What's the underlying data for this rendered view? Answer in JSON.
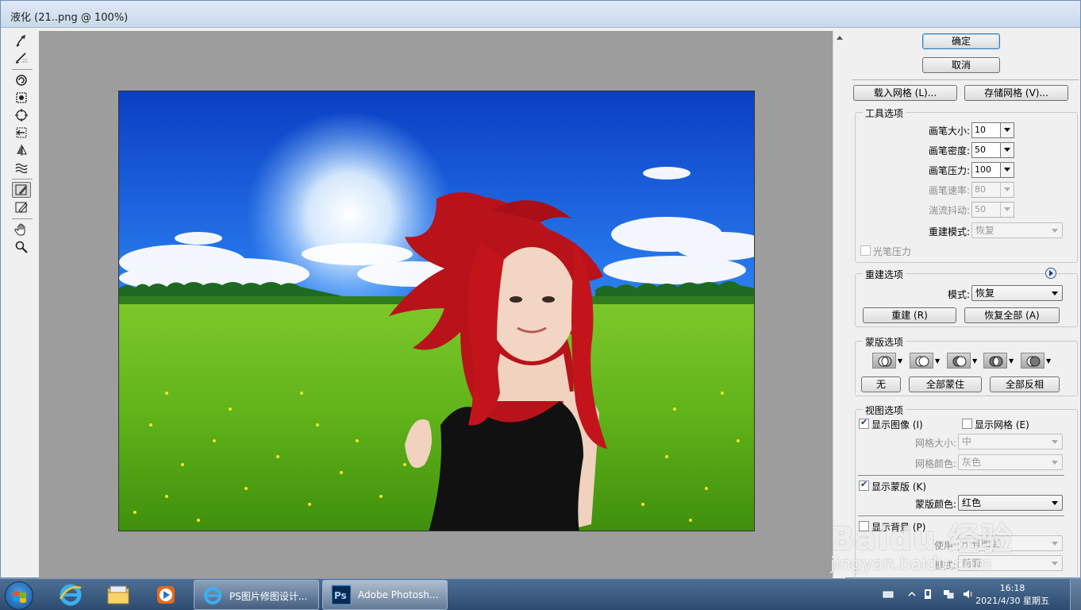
{
  "window": {
    "title": "液化 (21..png @ 100%)"
  },
  "panel": {
    "ok_label": "确定",
    "cancel_label": "取消",
    "load_mesh_label": "载入网格 (L)...",
    "save_mesh_label": "存储网格 (V)...",
    "tool_options": {
      "title": "工具选项",
      "brush_size": {
        "label": "画笔大小:",
        "value": "10"
      },
      "brush_density": {
        "label": "画笔密度:",
        "value": "50"
      },
      "brush_pressure": {
        "label": "画笔压力:",
        "value": "100"
      },
      "brush_rate": {
        "label": "画笔速率:",
        "value": "80"
      },
      "turbulent_jitter": {
        "label": "湍流抖动:",
        "value": "50"
      },
      "reconstruct_mode": {
        "label": "重建模式:",
        "value": "恢复"
      },
      "stylus_pressure": {
        "label": "光笔压力",
        "checked": false
      }
    },
    "reconstruct_options": {
      "title": "重建选项",
      "mode_label": "模式:",
      "mode_value": "恢复",
      "reconstruct_label": "重建 (R)",
      "restore_all_label": "恢复全部 (A)"
    },
    "mask_options": {
      "title": "蒙版选项",
      "none_label": "无",
      "mask_all_label": "全部蒙住",
      "invert_all_label": "全部反相"
    },
    "view_options": {
      "title": "视图选项",
      "show_image": {
        "label": "显示图像 (I)",
        "checked": true
      },
      "show_mesh": {
        "label": "显示网格 (E)",
        "checked": false
      },
      "mesh_size": {
        "label": "网格大小:",
        "value": "中"
      },
      "mesh_color": {
        "label": "网格颜色:",
        "value": "灰色"
      },
      "show_mask": {
        "label": "显示蒙版 (K)",
        "checked": true
      },
      "mask_color": {
        "label": "蒙版颜色:",
        "value": "红色"
      },
      "show_backdrop": {
        "label": "显示背景 (P)",
        "checked": false
      },
      "use": {
        "label": "使用:",
        "value": "所有图层"
      },
      "mode": {
        "label": "模式:",
        "value": "前面"
      }
    }
  },
  "taskbar": {
    "tasks": [
      {
        "label": "PS图片修图设计..."
      },
      {
        "label": "Adobe Photosh..."
      }
    ],
    "clock_time": "16:18",
    "clock_date": "2021/4/30 星期五"
  },
  "watermark": {
    "brand": "Baidu 经验",
    "url": "jingyan.baidu.com"
  }
}
